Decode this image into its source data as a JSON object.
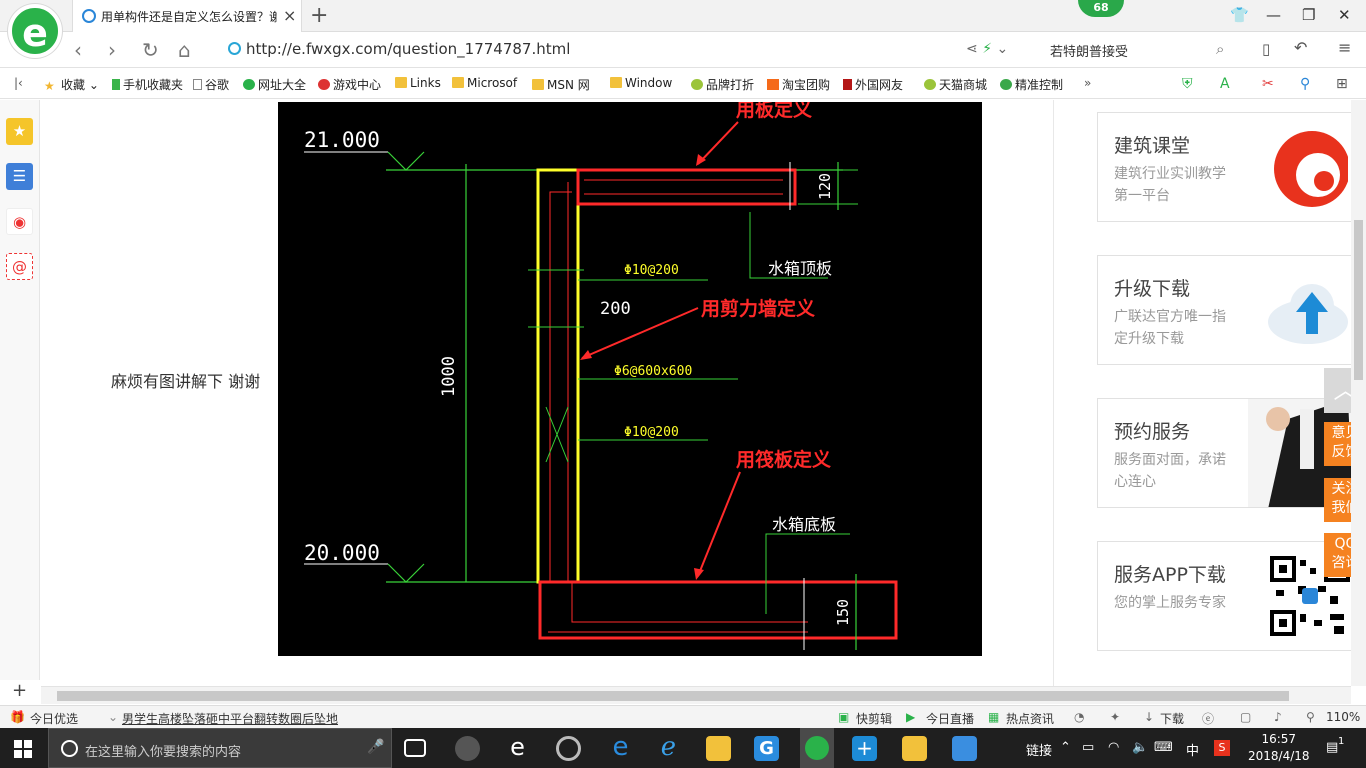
{
  "browser": {
    "logo_letter": "e",
    "tab_title": "用单构件还是自定义怎么设置？谢",
    "tab_close": "×",
    "new_tab": "+",
    "badge": "68",
    "url": "http://e.fwxgx.com/question_1774787.html",
    "hot_search": "若特朗普接受",
    "back": "‹",
    "forward": "›",
    "reload": "↻",
    "home": "⌂"
  },
  "bookmarks": [
    {
      "label": "收藏",
      "icon": "star-icon"
    },
    {
      "label": "手机收藏夹",
      "icon": "phone-icon"
    },
    {
      "label": "谷歌",
      "icon": "page-icon"
    },
    {
      "label": "网址大全",
      "icon": "site-icon"
    },
    {
      "label": "游戏中心",
      "icon": "game-icon"
    },
    {
      "label": "Links",
      "icon": "folder-icon"
    },
    {
      "label": "Microsof",
      "icon": "folder-icon"
    },
    {
      "label": "MSN 网",
      "icon": "folder-icon"
    },
    {
      "label": "Window",
      "icon": "folder-icon"
    },
    {
      "label": "品牌打折",
      "icon": "leaf-icon"
    },
    {
      "label": "淘宝团购",
      "icon": "taobao-icon"
    },
    {
      "label": "外国网友",
      "icon": "bookmark-icon"
    },
    {
      "label": "天猫商城",
      "icon": "leaf-icon"
    },
    {
      "label": "精准控制",
      "icon": "chat-icon"
    }
  ],
  "bookmarks_more": "»",
  "question_text": "麻烦有图讲解下 谢谢",
  "drawing": {
    "elev_top": "21.000",
    "elev_bottom": "20.000",
    "dim_top": "120",
    "dim_bottom": "150",
    "dim_height": "1000",
    "dim_wall": "200",
    "label_slab": "用板定义",
    "label_wall": "用剪力墙定义",
    "label_raft": "用筏板定义",
    "rebar_1": "Φ10@200",
    "rebar_2": "Φ6@600x600",
    "rebar_3": "Φ10@200",
    "top_slab_note": "水箱顶板",
    "bottom_slab_note": "水箱底板"
  },
  "cards": [
    {
      "title": "建筑课堂",
      "desc": "建筑行业实训教学第一平台",
      "icon": "swirl-logo-icon"
    },
    {
      "title": "升级下载",
      "desc": "广联达官方唯一指定升级下载",
      "icon": "cloud-upload-icon"
    },
    {
      "title": "预约服务",
      "desc": "服务面对面，承诺心连心",
      "icon": "person-photo-icon"
    },
    {
      "title": "服务APP下载",
      "desc": "您的掌上服务专家",
      "icon": "qrcode-icon"
    }
  ],
  "float_buttons": {
    "top": "︿",
    "feedback": "意见反馈",
    "follow": "关注我们",
    "qq": "QQ咨询"
  },
  "status_bar": {
    "today": "今日优选",
    "news": "男学生高楼坠落砸中平台翻转数圈后坠地",
    "kuaijianji": "快剪辑",
    "live": "今日直播",
    "hotnews": "热点资讯",
    "download": "下载",
    "zoom": "110%"
  },
  "taskbar": {
    "search_placeholder": "在这里输入你要搜索的内容",
    "links": "链接",
    "ime": "中",
    "time": "16:57",
    "date": "2018/4/18",
    "notification_count": "1"
  }
}
